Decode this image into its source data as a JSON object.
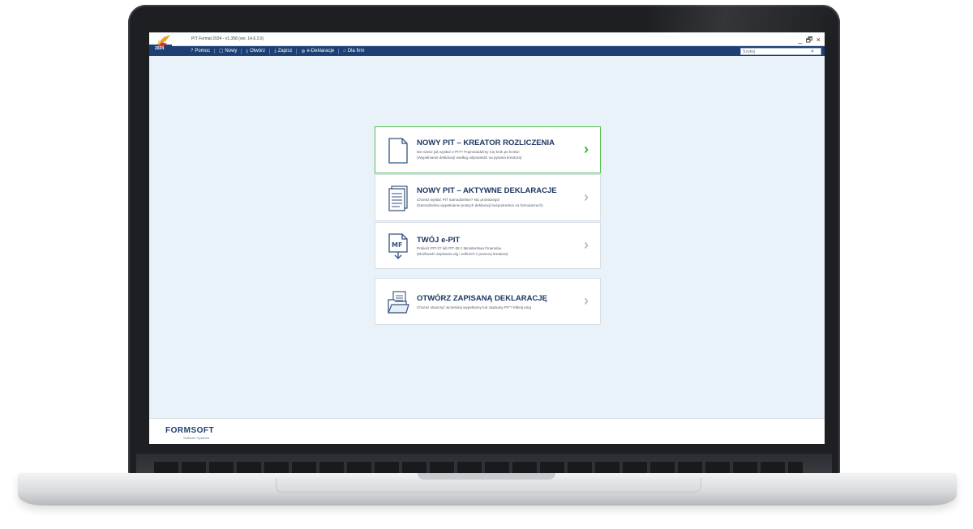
{
  "app": {
    "title": "PIT Format 2024 - v1.358 (ver. 14.6.3.0)",
    "year_badge": "2024",
    "window_controls": "_ 🗗 ×"
  },
  "menu": [
    {
      "icon": "?",
      "label": "Pomoc",
      "icon_name": "help-icon"
    },
    {
      "icon": "☐",
      "label": "Nowy",
      "icon_name": "new-document-icon"
    },
    {
      "icon": "⤓",
      "label": "Otwórz",
      "icon_name": "open-icon"
    },
    {
      "icon": "⤓",
      "label": "Zapisz",
      "icon_name": "save-icon"
    },
    {
      "icon": "⊛",
      "label": "e-Deklaracje",
      "icon_name": "e-declaration-icon"
    },
    {
      "icon": "⌂",
      "label": "Dla firm",
      "icon_name": "business-icon"
    }
  ],
  "search": {
    "placeholder": "Szukaj",
    "icon": "⌕"
  },
  "cards": [
    {
      "title": "NOWY PIT – KREATOR ROZLICZENIA",
      "line1": "Nie wiesz jak wysłać e-PIT? Poprowadzimy Cię krok po kroku!",
      "line2": "(Wypełnianie deklaracji według odpowiedzi na pytania kreatora)",
      "chevron": "›",
      "active": true
    },
    {
      "title": "NOWY PIT – AKTYWNE DEKLARACJE",
      "line1": "Chcesz wysłać PIT samodzielnie? Nic prostszego!",
      "line2": "(Samodzielne wypełnianie pustych deklaracji bezpośrednio na formularzach)",
      "chevron": "›",
      "active": false
    },
    {
      "title": "TWÓJ e-PIT",
      "line1": "Pobierz PIT-37 lub PIT-38 z Ministerstwa Finansów.",
      "line2": "(Możliwość dopisania ulg i odliczeń z pomocą kreatora)",
      "badge": "MF",
      "chevron": "›",
      "active": false
    },
    {
      "title": "OTWÓRZ ZAPISANĄ DEKLARACJĘ",
      "line1": "Chcesz otworzyć wcześniej wypełniony lub zapisany PIT? Kliknij tutaj",
      "line2": "",
      "chevron": "›",
      "active": false
    }
  ],
  "footer": {
    "brand": "FORMSOFT",
    "tagline": "Software Systems"
  },
  "colors": {
    "menubar": "#1d3f73",
    "accent_green": "#3cb43a",
    "title_navy": "#1c3661",
    "screen_bg": "#e9f1f9"
  }
}
